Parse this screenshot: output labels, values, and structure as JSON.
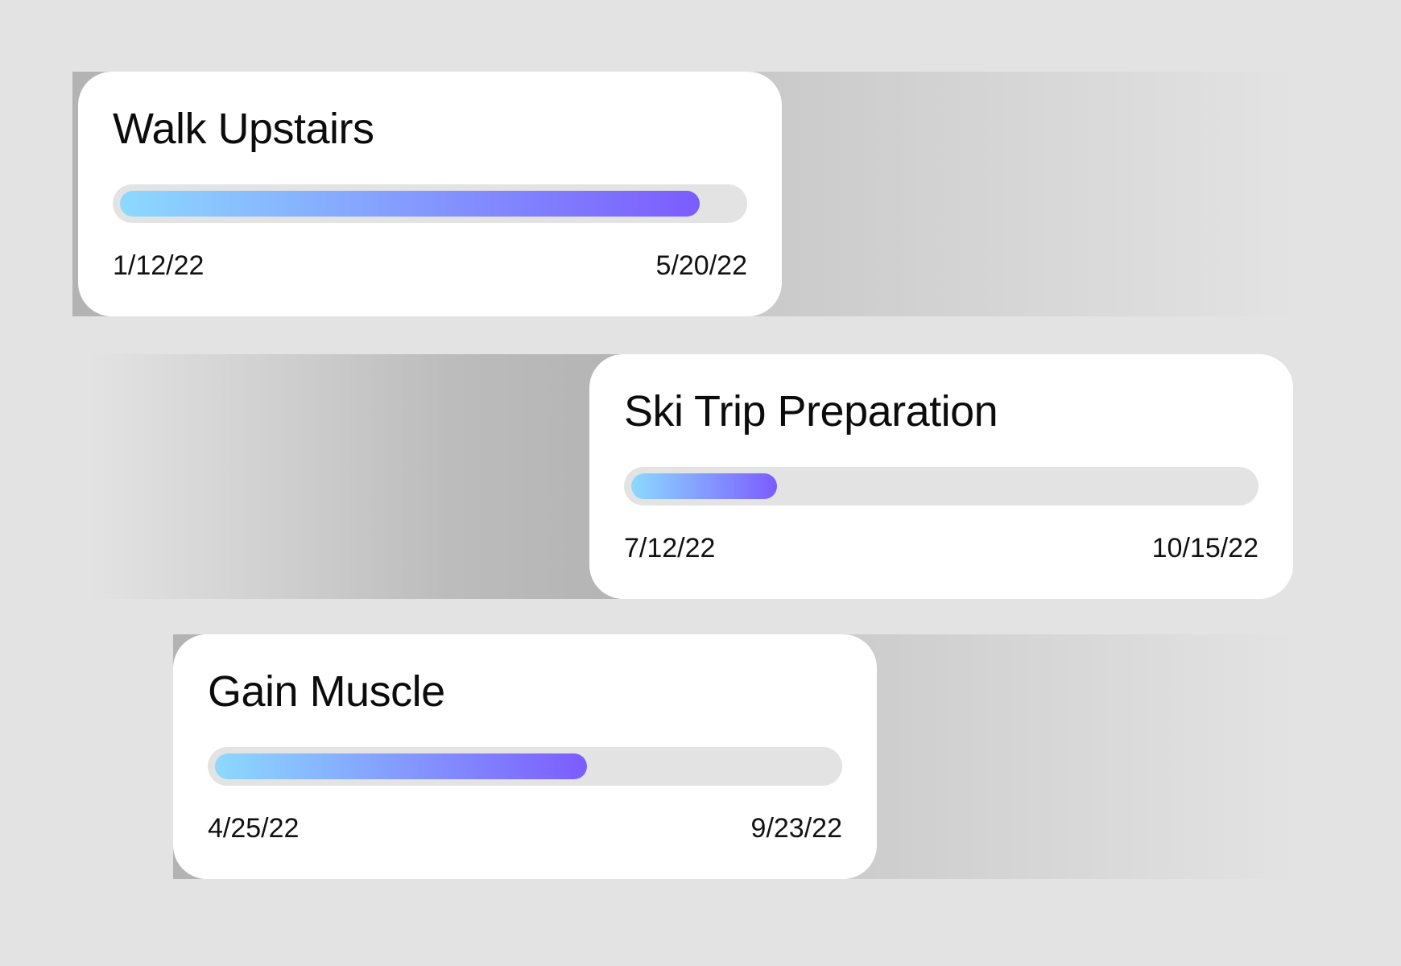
{
  "colors": {
    "background": "#e3e3e3",
    "card": "#ffffff",
    "progress_start": "#8cd9ff",
    "progress_end": "#7c5cff"
  },
  "goals": [
    {
      "title": "Walk Upstairs",
      "start_date": "1/12/22",
      "end_date": "5/20/22",
      "progress": 0.935
    },
    {
      "title": "Ski Trip Preparation",
      "start_date": "7/12/22",
      "end_date": "10/15/22",
      "progress": 0.235
    },
    {
      "title": "Gain Muscle",
      "start_date": "4/25/22",
      "end_date": "9/23/22",
      "progress": 0.6
    }
  ]
}
